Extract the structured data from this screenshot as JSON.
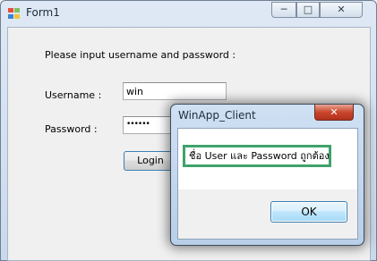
{
  "form": {
    "title": "Form1",
    "caption_buttons": {
      "minimize": "─",
      "maximize": "□",
      "close": "✕"
    },
    "prompt": "Please input username and password :",
    "username_label": "Username :",
    "username_value": "win",
    "password_label": "Password :",
    "password_value": "••••••",
    "login_label": "Login"
  },
  "dialog": {
    "title": "WinApp_Client",
    "close": "✕",
    "message": "ชื่อ User และ Password ถูกต้อง",
    "ok_label": "OK",
    "highlight_color": "#3fa36b"
  },
  "icons": {
    "app": "windows-form-icon"
  }
}
